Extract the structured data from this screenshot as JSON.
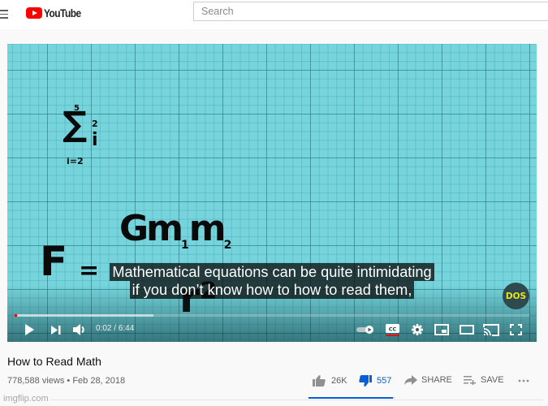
{
  "header": {
    "logo_text": "YouTube",
    "search_placeholder": "Search",
    "search_value": ""
  },
  "video": {
    "math_display": {
      "sigma_upper": "5",
      "sigma_symbol": "∑",
      "sigma_term": "i",
      "sigma_exponent": "2",
      "sigma_lower": "i=2",
      "formula_lhs": "F",
      "formula_equals": "=",
      "formula_numerator": "Gm",
      "formula_numerator_sub1": "1",
      "formula_numerator_m2": "m",
      "formula_numerator_sub2": "2",
      "formula_denominator": "r²"
    },
    "captions": [
      "Mathematical equations can be quite intimidating",
      "if you don’t know how to how to read them,"
    ],
    "channel_watermark": "DOS",
    "progress": {
      "played_fraction": 0.005,
      "loaded_fraction": 0.27
    },
    "time_current": "0:02",
    "time_total": "6:44",
    "time_display": "0:02 / 6:44",
    "controls": {
      "play": "play-icon",
      "next": "next-icon",
      "volume": "volume-icon",
      "autoplay": "autoplay-toggle",
      "captions": "CC",
      "settings": "gear-icon",
      "miniplayer": "miniplayer-icon",
      "theater": "theater-icon",
      "cast": "cast-icon",
      "fullscreen": "fullscreen-icon"
    }
  },
  "info": {
    "title": "How to Read Math",
    "views": "778,588 views",
    "separator": "•",
    "date": "Feb 28, 2018",
    "like_count": "26K",
    "dislike_count": "557",
    "share_label": "SHARE",
    "save_label": "SAVE",
    "sentiment_like_fraction": 0.979,
    "colors": {
      "accent_blue": "#065fd4",
      "logo_red": "#ff0000"
    }
  },
  "watermark": "imgflip.com"
}
